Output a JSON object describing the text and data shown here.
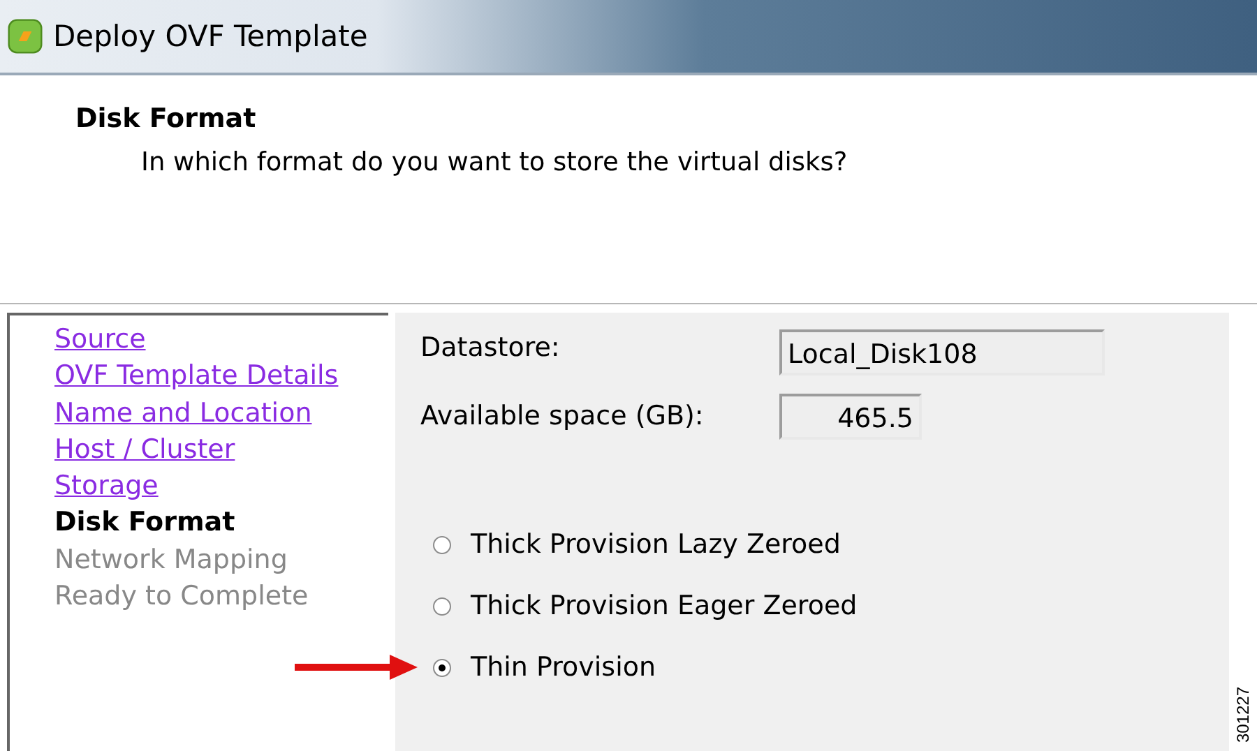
{
  "window": {
    "title": "Deploy OVF Template"
  },
  "header": {
    "title": "Disk Format",
    "subtitle": "In which format do you want to store the virtual disks?"
  },
  "steps": [
    {
      "label": "Source",
      "kind": "link"
    },
    {
      "label": "OVF Template Details",
      "kind": "link"
    },
    {
      "label": "Name and Location",
      "kind": "link"
    },
    {
      "label": "Host / Cluster",
      "kind": "link"
    },
    {
      "label": "Storage",
      "kind": "link"
    },
    {
      "label": "Disk Format",
      "kind": "current"
    },
    {
      "label": "Network Mapping",
      "kind": "pending"
    },
    {
      "label": "Ready to Complete",
      "kind": "pending"
    }
  ],
  "fields": [
    {
      "label": "Datastore:",
      "value": "Local_Disk108",
      "kind": "wide"
    },
    {
      "label": "Available space (GB):",
      "value": "465.5",
      "kind": "number"
    }
  ],
  "options": [
    {
      "label": "Thick Provision Lazy Zeroed",
      "selected": false,
      "pointed": false
    },
    {
      "label": "Thick Provision Eager Zeroed",
      "selected": false,
      "pointed": false
    },
    {
      "label": "Thin Provision",
      "selected": true,
      "pointed": true
    }
  ],
  "figure_id": "301227"
}
